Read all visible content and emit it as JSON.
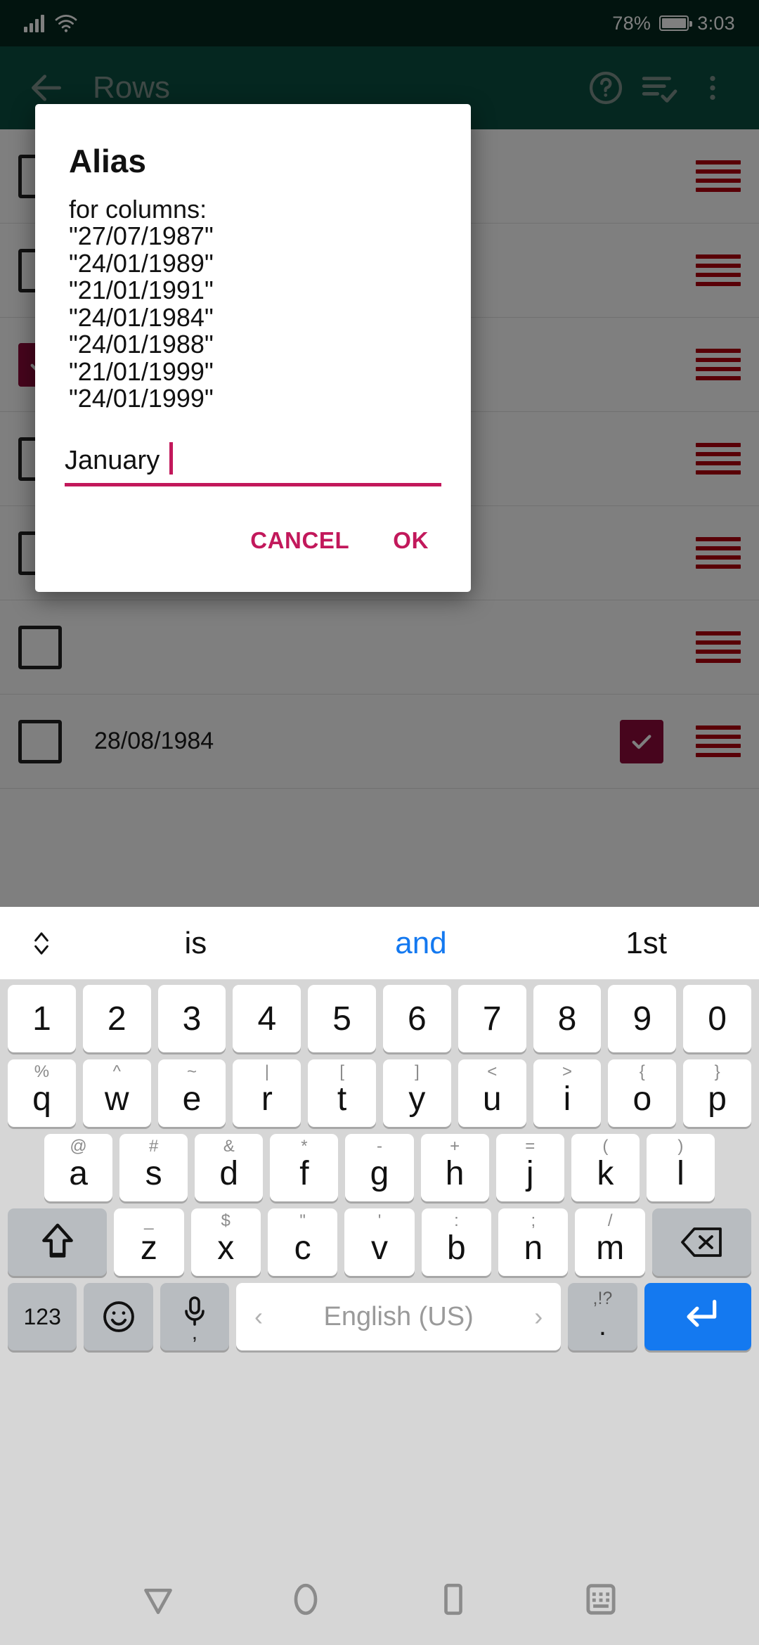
{
  "status_bar": {
    "battery_percent": "78%",
    "time": "3:03",
    "icons": [
      "signal-bars-icon",
      "wifi-icon",
      "battery-icon"
    ]
  },
  "app_bar": {
    "title": "Rows",
    "back_icon": "arrow-left-icon",
    "help_icon": "help-circle-icon",
    "select_icon": "list-check-icon",
    "overflow_icon": "more-vertical-icon"
  },
  "background_list": {
    "visible_row_label": "28/08/1984"
  },
  "dialog": {
    "title": "Alias",
    "subtitle": "for columns:",
    "columns": [
      "\"27/07/1987\"",
      "\"24/01/1989\"",
      "\"21/01/1991\"",
      "\"24/01/1984\"",
      "\"24/01/1988\"",
      "\"21/01/1999\"",
      "\"24/01/1999\""
    ],
    "input_value": "January",
    "input_placeholder": "",
    "cancel_label": "CANCEL",
    "ok_label": "OK",
    "accent_color": "#c2185b"
  },
  "keyboard": {
    "suggestions": [
      {
        "text": "is",
        "highlighted": false
      },
      {
        "text": "and",
        "highlighted": true
      },
      {
        "text": "1st",
        "highlighted": false
      }
    ],
    "expand_icon": "chevron-updown-icon",
    "row_numbers": [
      {
        "main": "1"
      },
      {
        "main": "2"
      },
      {
        "main": "3"
      },
      {
        "main": "4"
      },
      {
        "main": "5"
      },
      {
        "main": "6"
      },
      {
        "main": "7"
      },
      {
        "main": "8"
      },
      {
        "main": "9"
      },
      {
        "main": "0"
      }
    ],
    "row_top": [
      {
        "alt": "%",
        "main": "q"
      },
      {
        "alt": "^",
        "main": "w"
      },
      {
        "alt": "~",
        "main": "e"
      },
      {
        "alt": "|",
        "main": "r"
      },
      {
        "alt": "[",
        "main": "t"
      },
      {
        "alt": "]",
        "main": "y"
      },
      {
        "alt": "<",
        "main": "u"
      },
      {
        "alt": ">",
        "main": "i"
      },
      {
        "alt": "{",
        "main": "o"
      },
      {
        "alt": "}",
        "main": "p"
      }
    ],
    "row_home": [
      {
        "alt": "@",
        "main": "a"
      },
      {
        "alt": "#",
        "main": "s"
      },
      {
        "alt": "&",
        "main": "d"
      },
      {
        "alt": "*",
        "main": "f"
      },
      {
        "alt": "-",
        "main": "g"
      },
      {
        "alt": "+",
        "main": "h"
      },
      {
        "alt": "=",
        "main": "j"
      },
      {
        "alt": "(",
        "main": "k"
      },
      {
        "alt": ")",
        "main": "l"
      }
    ],
    "row_bottom": [
      {
        "alt": "_",
        "main": "z"
      },
      {
        "alt": "$",
        "main": "x"
      },
      {
        "alt": "\"",
        "main": "c"
      },
      {
        "alt": "'",
        "main": "v"
      },
      {
        "alt": ":",
        "main": "b"
      },
      {
        "alt": ";",
        "main": "n"
      },
      {
        "alt": "/",
        "main": "m"
      }
    ],
    "shift_icon": "shift-arrow-icon",
    "delete_icon": "backspace-icon",
    "numeric_key_label": "123",
    "emoji_icon": "emoji-smiley-icon",
    "mic_icon": "microphone-icon",
    "mic_alt": ",",
    "space_label": "English (US)",
    "space_prev_icon": "chevron-left-icon",
    "space_next_icon": "chevron-right-icon",
    "punct_alt": ",!?",
    "punct_main": ".",
    "enter_icon": "enter-return-icon",
    "enter_color": "#1479f0"
  },
  "nav_bar": {
    "back_icon": "nav-back-triangle-icon",
    "home_icon": "nav-home-circle-icon",
    "recents_icon": "nav-recents-square-icon",
    "hide_keyboard_icon": "hide-keyboard-icon"
  }
}
